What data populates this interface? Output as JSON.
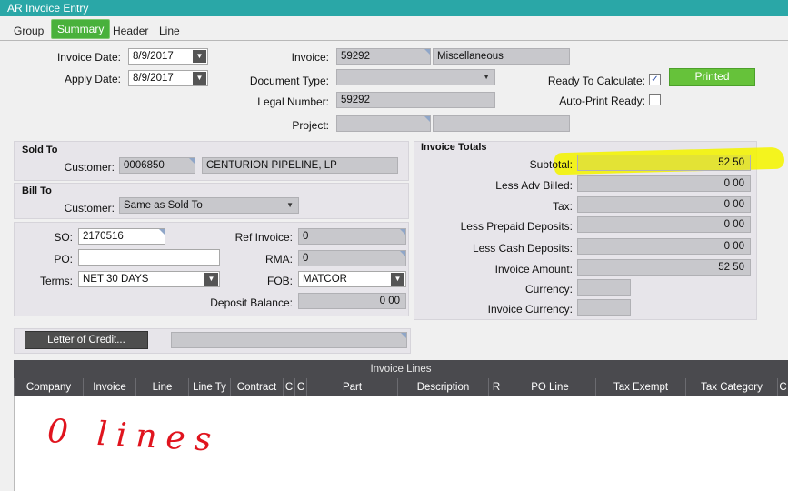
{
  "window": {
    "title": "AR Invoice Entry"
  },
  "tabs": [
    {
      "label": "Group"
    },
    {
      "label": "Summary"
    },
    {
      "label": "Header"
    },
    {
      "label": "Line"
    }
  ],
  "header": {
    "invoice_date_label": "Invoice Date:",
    "invoice_date_value": "8/9/2017",
    "apply_date_label": "Apply Date:",
    "apply_date_value": "8/9/2017",
    "invoice_label": "Invoice:",
    "invoice_value": "59292",
    "invoice_desc": "Miscellaneous",
    "document_type_label": "Document Type:",
    "document_type_value": "",
    "legal_number_label": "Legal Number:",
    "legal_number_value": "59292",
    "project_label": "Project:",
    "project_value": "",
    "project_desc": "",
    "ready_label": "Ready To Calculate:",
    "ready_checked": "✓",
    "auto_print_label": "Auto-Print Ready:",
    "auto_print_checked": "",
    "status_button": "Printed"
  },
  "sold_to": {
    "title": "Sold To",
    "customer_label": "Customer:",
    "customer_id": "0006850",
    "customer_name": "CENTURION PIPELINE, LP"
  },
  "bill_to": {
    "title": "Bill To",
    "customer_label": "Customer:",
    "customer_value": "Same as Sold To"
  },
  "details": {
    "so_label": "SO:",
    "so_value": "2170516",
    "po_label": "PO:",
    "po_value": "",
    "terms_label": "Terms:",
    "terms_value": "NET 30 DAYS",
    "ref_invoice_label": "Ref Invoice:",
    "ref_invoice_value": "0",
    "rma_label": "RMA:",
    "rma_value": "0",
    "fob_label": "FOB:",
    "fob_value": "MATCOR",
    "deposit_balance_label": "Deposit Balance:",
    "deposit_balance_value": "0 00"
  },
  "totals": {
    "title": "Invoice Totals",
    "rows": [
      {
        "label": "Subtotal:",
        "value": "52 50"
      },
      {
        "label": "Less Adv Billed:",
        "value": "0 00"
      },
      {
        "label": "Tax:",
        "value": "0 00"
      },
      {
        "label": "Less Prepaid Deposits:",
        "value": "0 00"
      },
      {
        "label": "Less Cash Deposits:",
        "value": "0 00"
      },
      {
        "label": "Invoice Amount:",
        "value": "52 50"
      },
      {
        "label": "Currency:",
        "value": ""
      },
      {
        "label": "Invoice Currency:",
        "value": ""
      }
    ]
  },
  "letter_of_credit": {
    "button": "Letter of Credit...",
    "value": ""
  },
  "grid": {
    "title": "Invoice Lines",
    "columns": [
      "Company",
      "Invoice",
      "Line",
      "Line Ty",
      "Contract",
      "C",
      "C",
      "Part",
      "Description",
      "R",
      "PO Line",
      "Tax Exempt",
      "Tax Category",
      "C"
    ]
  },
  "annotation": {
    "text": "0 lines",
    "color": "#e0141e",
    "highlight_color": "#f4f400"
  },
  "colors": {
    "title_bar": "#2aa7a7",
    "active_tab": "#49b13c",
    "printed": "#66c23a",
    "grid_header": "#4a4a4e"
  }
}
